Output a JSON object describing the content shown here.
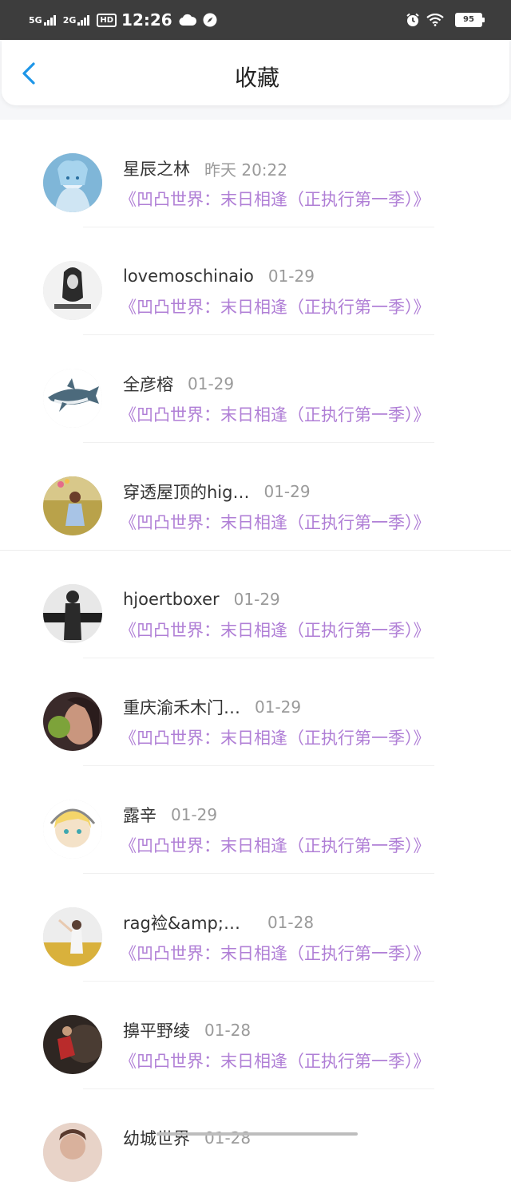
{
  "status_bar": {
    "sig1": "5G",
    "sig2": "2G",
    "hd": "HD",
    "time": "12:26",
    "battery": "95"
  },
  "header": {
    "title": "收藏",
    "back_icon": "chevron-left-icon"
  },
  "items": [
    {
      "name": "星辰之林",
      "time": "昨天 20:22",
      "title": "《凹凸世界：末日相逢（正执行第一季）》"
    },
    {
      "name": "lovemoschinaio",
      "time": "01-29",
      "title": "《凹凸世界：末日相逢（正执行第一季）》"
    },
    {
      "name": "全彦榕",
      "time": "01-29",
      "title": "《凹凸世界：末日相逢（正执行第一季）》"
    },
    {
      "name": "穿透屋顶的hig…",
      "time": "01-29",
      "title": "《凹凸世界：末日相逢（正执行第一季）》"
    },
    {
      "name": "hjoertboxer",
      "time": "01-29",
      "title": "《凹凸世界：末日相逢（正执行第一季）》"
    },
    {
      "name": "重庆渝禾木门…",
      "time": "01-29",
      "title": "《凹凸世界：末日相逢（正执行第一季）》"
    },
    {
      "name": "露辛",
      "time": "01-29",
      "title": "《凹凸世界：末日相逢（正执行第一季）》"
    },
    {
      "name": "rag裣&amp;…",
      "time": "01-28",
      "title": "《凹凸世界：末日相逢（正执行第一季）》"
    },
    {
      "name": "擤平野绫",
      "time": "01-28",
      "title": "《凹凸世界：末日相逢（正执行第一季）》"
    },
    {
      "name": "幼城世界",
      "time": "01-28",
      "title": ""
    }
  ],
  "colors": {
    "accent": "#1e96e8",
    "title_link": "#b07fd6",
    "status_bar": "#3d3d3d"
  }
}
